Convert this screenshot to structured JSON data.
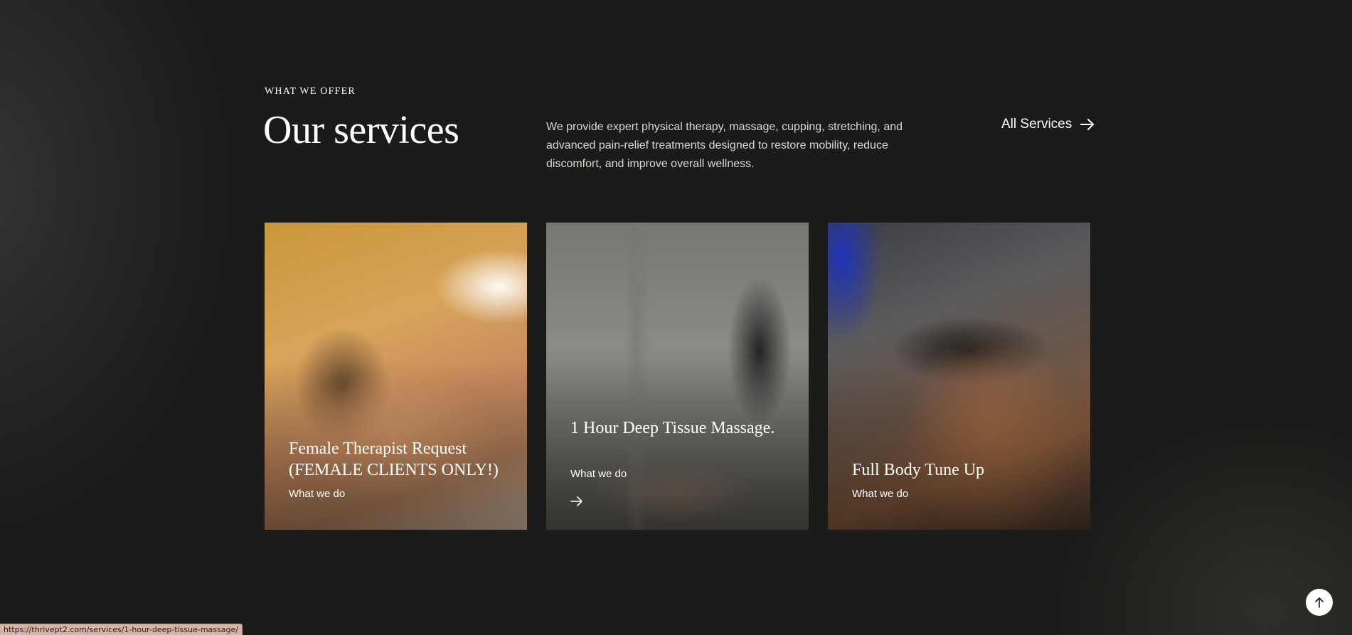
{
  "section": {
    "eyebrow": "WHAT WE OFFER",
    "title": "Our services",
    "intro": "We provide expert physical therapy, massage, cupping, stretching, and advanced pain-relief treatments designed to restore mobility, reduce discomfort, and improve overall wellness.",
    "all_services_label": "All Services"
  },
  "cards": [
    {
      "title": "Female Therapist Request (FEMALE CLIENTS ONLY!)",
      "subtitle": "What we do"
    },
    {
      "title": "1 Hour Deep Tissue Massage.",
      "subtitle": "What we do"
    },
    {
      "title": "Full Body Tune Up",
      "subtitle": "What we do"
    }
  ],
  "status_bar": {
    "url": "https://thrivept2.com/services/1-hour-deep-tissue-massage/"
  },
  "icons": {
    "all_services": "arrow-right-icon",
    "card_hover": "arrow-right-icon",
    "scroll_top": "arrow-up-icon"
  },
  "colors": {
    "background": "#1b1b19",
    "text": "#ffffff",
    "body_text": "#d9d9d6",
    "status_bar": "#d7b2a6"
  }
}
